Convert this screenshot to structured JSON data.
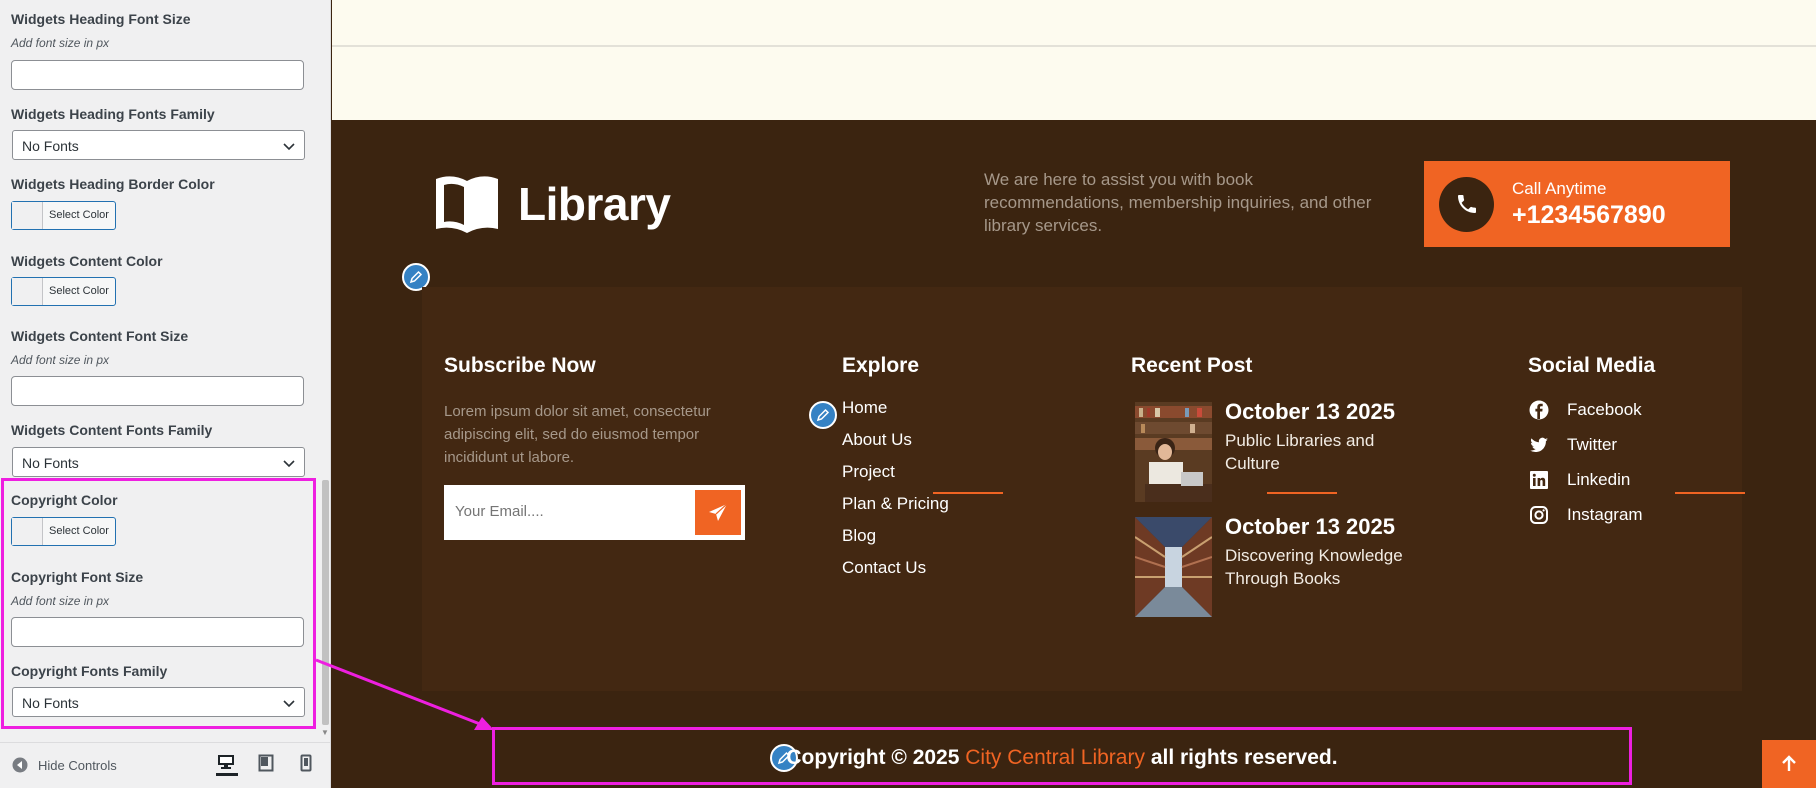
{
  "sidebar": {
    "controls": [
      {
        "title": "Widgets Heading Font Size",
        "desc": "Add font size in px"
      },
      {
        "title": "Widgets Heading Fonts Family",
        "value": "No Fonts"
      },
      {
        "title": "Widgets Heading Border Color",
        "button": "Select Color"
      },
      {
        "title": "Widgets Content Color",
        "button": "Select Color"
      },
      {
        "title": "Widgets Content Font Size",
        "desc": "Add font size in px"
      },
      {
        "title": "Widgets Content Fonts Family",
        "value": "No Fonts"
      },
      {
        "title": "Copyright Color",
        "button": "Select Color"
      },
      {
        "title": "Copyright Font Size",
        "desc": "Add font size in px"
      },
      {
        "title": "Copyright Fonts Family",
        "value": "No Fonts"
      }
    ],
    "hide_controls": "Hide Controls"
  },
  "preview": {
    "logo_text": "Library",
    "intro": "We are here to assist you with book recommendations, membership inquiries, and other library services.",
    "call_label": "Call Anytime",
    "call_number": "+1234567890",
    "subscribe": {
      "title": "Subscribe Now",
      "text": "Lorem ipsum dolor sit amet, consectetur adipiscing elit, sed do eiusmod tempor incididunt ut labore.",
      "placeholder": "Your Email...."
    },
    "explore": {
      "title": "Explore",
      "links": [
        "Home",
        "About Us",
        "Project",
        "Plan & Pricing",
        "Blog",
        "Contact Us"
      ]
    },
    "recent": {
      "title": "Recent Post",
      "posts": [
        {
          "date": "October 13 2025",
          "title": "Public Libraries and Culture"
        },
        {
          "date": "October 13 2025",
          "title": "Discovering Knowledge Through Books"
        }
      ]
    },
    "social": {
      "title": "Social Media",
      "items": [
        "Facebook",
        "Twitter",
        "Linkedin",
        "Instagram"
      ]
    },
    "copyright": {
      "prefix": "Copyright © 2025",
      "link": "City Central Library",
      "suffix": "all rights reserved."
    }
  },
  "colors": {
    "accent": "#f06423",
    "footer_bg": "#3b2410",
    "widgets_bg": "#432812",
    "highlight": "#ee1fe0",
    "wp_blue": "#2271b1"
  }
}
